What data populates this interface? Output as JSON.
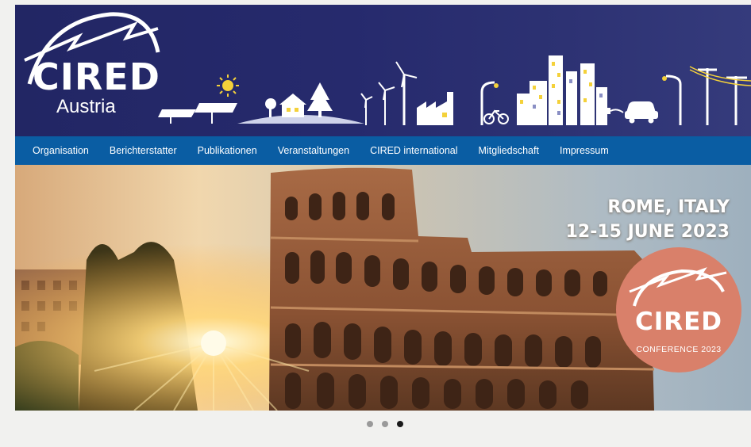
{
  "logo": {
    "title": "CIRED",
    "subtitle": "Austria"
  },
  "nav": {
    "items": [
      "Organisation",
      "Berichterstatter",
      "Publikationen",
      "Veranstaltungen",
      "CIRED international",
      "Mitgliedschaft",
      "Impressum"
    ]
  },
  "hero": {
    "location": "ROME, ITALY",
    "dates": "12-15 JUNE 2023",
    "badge_title": "CIRED",
    "badge_subtitle": "CONFERENCE 2023"
  },
  "carousel": {
    "slide_count": 3,
    "active_index": 2
  },
  "colors": {
    "banner": "#262a6d",
    "nav": "#0a5da3",
    "badge": "#d9806a",
    "page_bg": "#f1f1ef"
  }
}
